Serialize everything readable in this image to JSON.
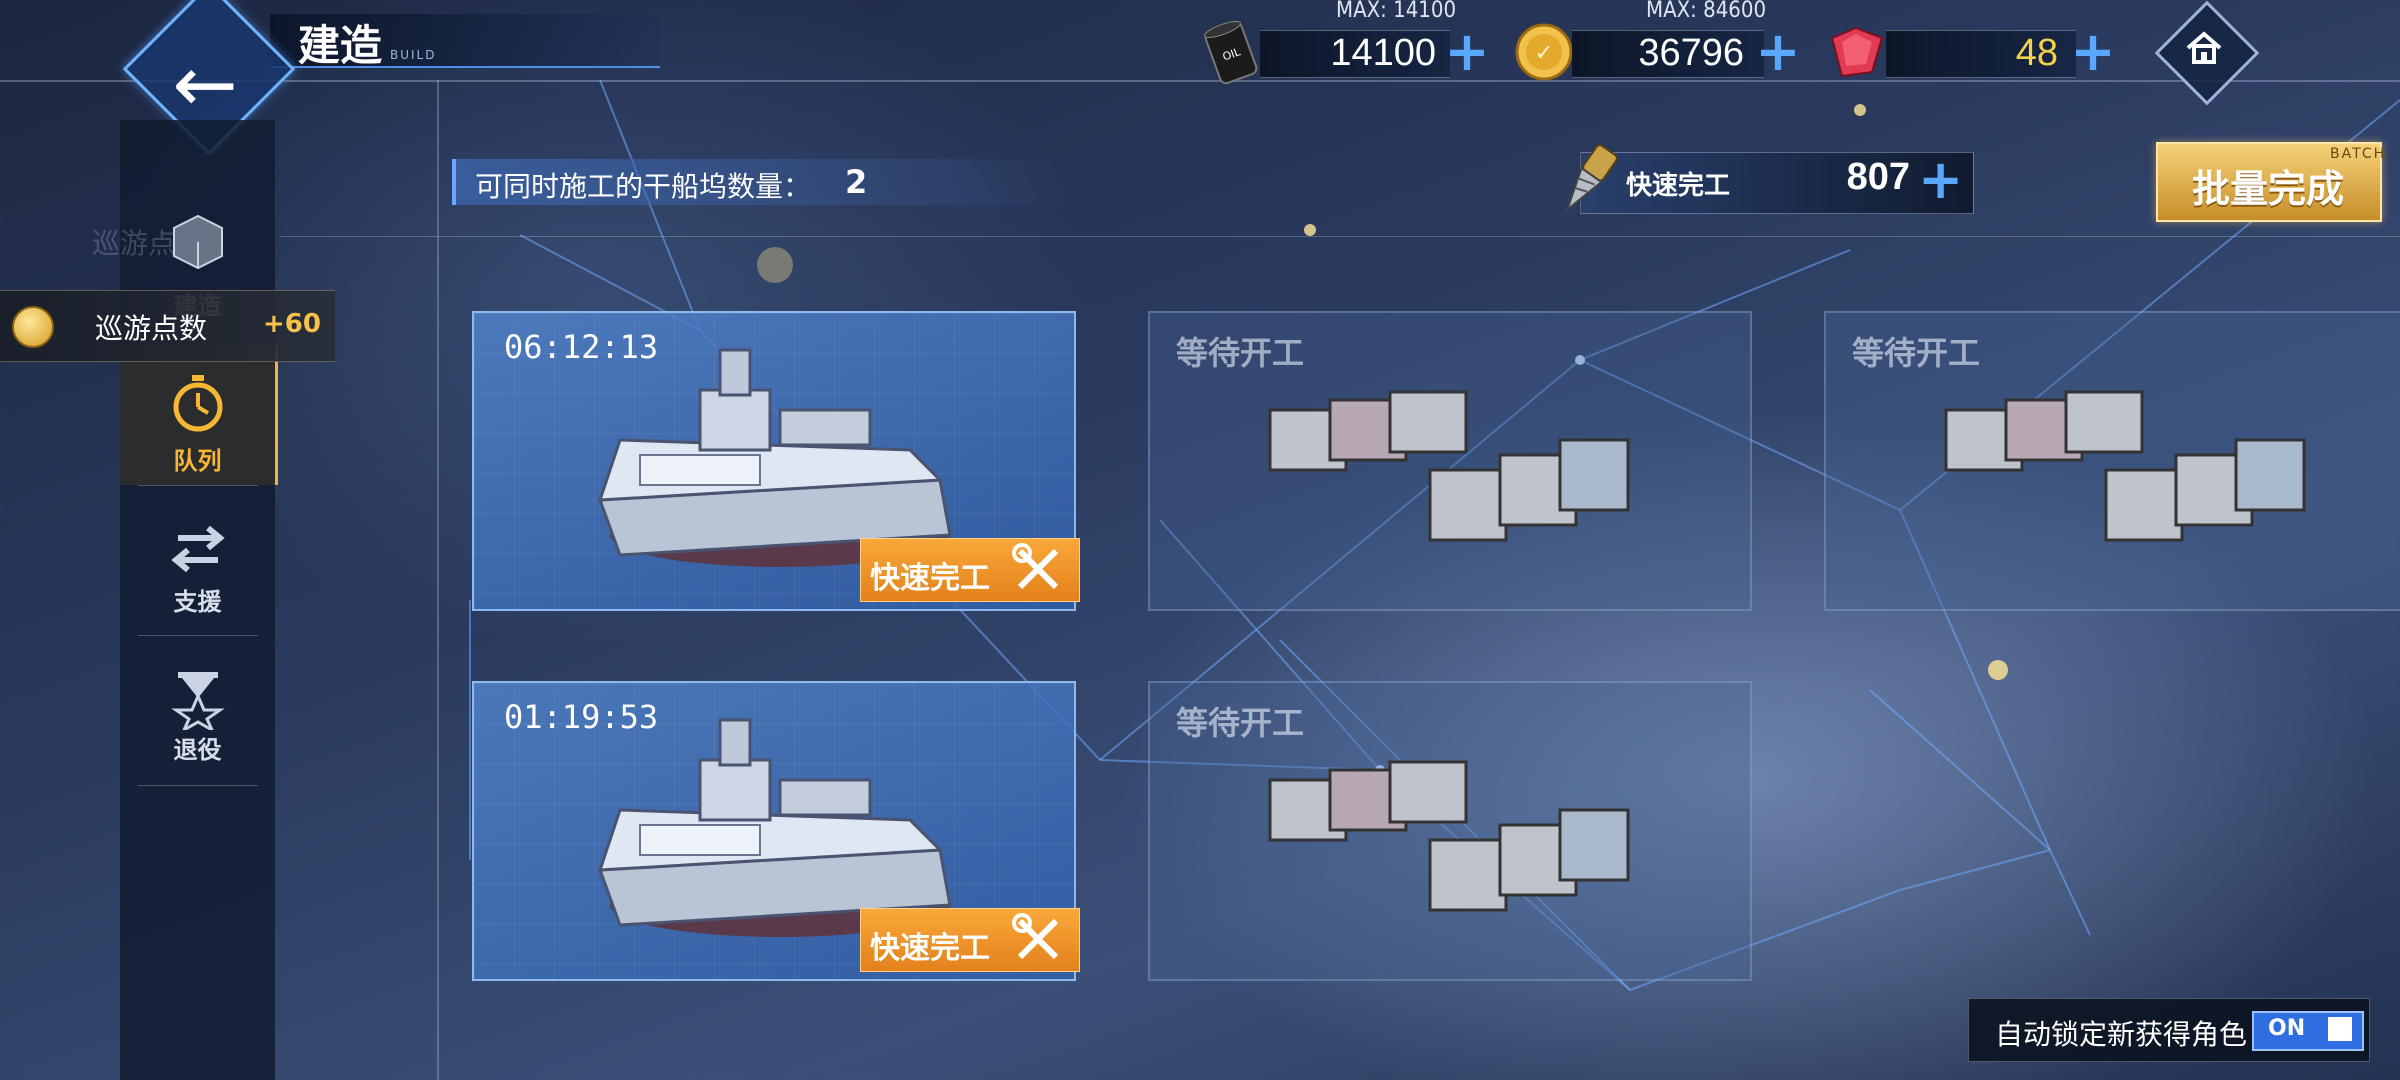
{
  "header": {
    "title": "建造",
    "subtitle": "BUILD"
  },
  "resources": {
    "oil": {
      "max_label": "MAX: 14100",
      "value": "14100",
      "icon": "oil-barrel-icon"
    },
    "coin": {
      "max_label": "MAX: 84600",
      "value": "36796",
      "icon": "gold-coin-icon"
    },
    "gem": {
      "value": "48",
      "icon": "ruby-gem-icon"
    },
    "add_symbol": "+"
  },
  "sidebar": {
    "ghost_text": "巡游点",
    "items": [
      {
        "label": "建造"
      },
      {
        "label": "队列"
      },
      {
        "label": "支援"
      },
      {
        "label": "退役"
      }
    ]
  },
  "cruise_points": {
    "label": "巡游点数",
    "value": "+60"
  },
  "dock_info": {
    "label": "可同时施工的干船坞数量：",
    "value": "2"
  },
  "quick_finish": {
    "label": "快速完工",
    "value": "807",
    "add": "+"
  },
  "batch": {
    "label": "批量完成",
    "sub": "BATCH"
  },
  "slots": [
    {
      "status": "building",
      "timer": "06:12:13",
      "button": "快速完工"
    },
    {
      "status": "waiting",
      "label": "等待开工"
    },
    {
      "status": "waiting",
      "label": "等待开工"
    },
    {
      "status": "building",
      "timer": "01:19:53",
      "button": "快速完工"
    },
    {
      "status": "waiting",
      "label": "等待开工"
    }
  ],
  "auto_lock": {
    "label": "自动锁定新获得角色",
    "state": "ON"
  },
  "colors": {
    "accent": "#5aa7ff",
    "gold": "#f7b733",
    "orange": "#f29b2e"
  }
}
